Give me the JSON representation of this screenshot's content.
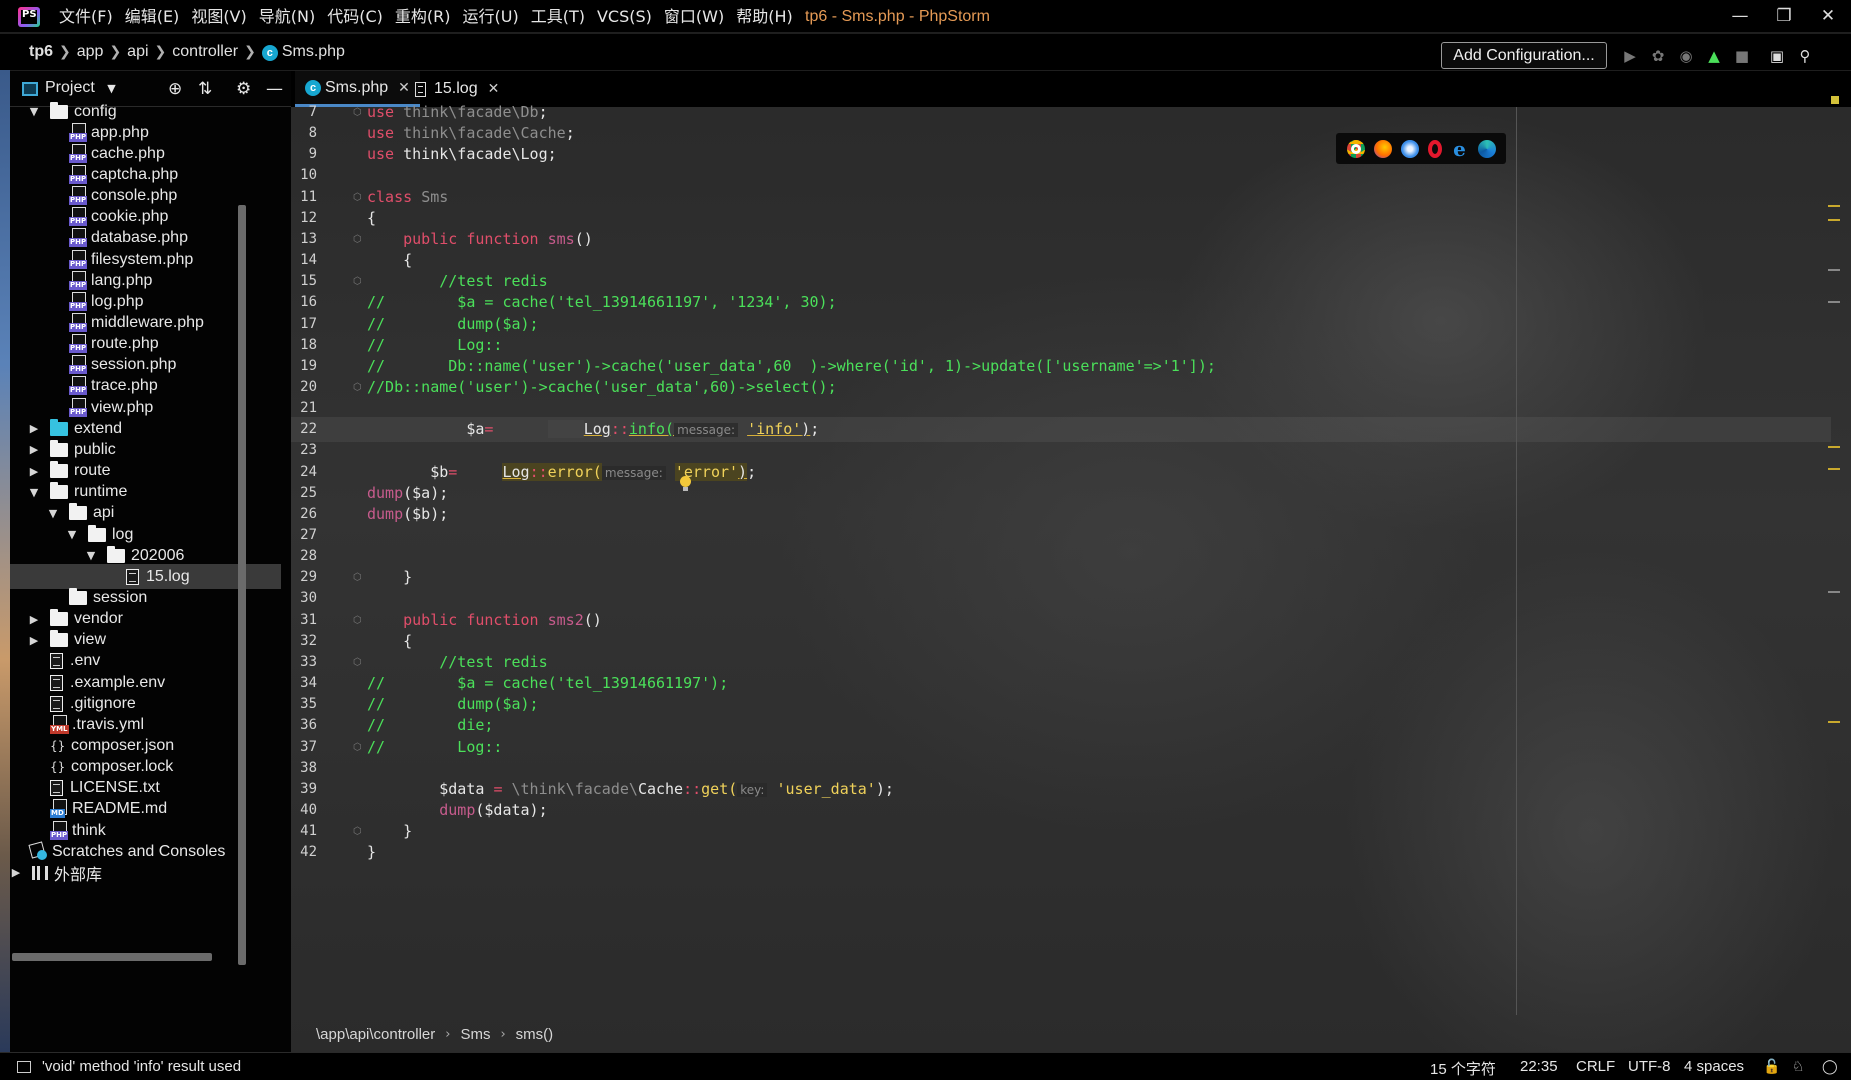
{
  "window": {
    "title": "tp6 - Sms.php - PhpStorm",
    "logo_text": "PS",
    "menu": [
      "文件(F)",
      "编辑(E)",
      "视图(V)",
      "导航(N)",
      "代码(C)",
      "重构(R)",
      "运行(U)",
      "工具(T)",
      "VCS(S)",
      "窗口(W)",
      "帮助(H)"
    ]
  },
  "navbar": {
    "breadcrumb": [
      "tp6",
      "app",
      "api",
      "controller",
      "Sms.php"
    ],
    "add_configuration": "Add Configuration..."
  },
  "project": {
    "title": "Project",
    "tree": [
      {
        "label": "config",
        "type": "folder",
        "depth": 1,
        "expanded": true
      },
      {
        "label": "app.php",
        "type": "php",
        "depth": 2
      },
      {
        "label": "cache.php",
        "type": "php",
        "depth": 2
      },
      {
        "label": "captcha.php",
        "type": "php",
        "depth": 2
      },
      {
        "label": "console.php",
        "type": "php",
        "depth": 2
      },
      {
        "label": "cookie.php",
        "type": "php",
        "depth": 2
      },
      {
        "label": "database.php",
        "type": "php",
        "depth": 2
      },
      {
        "label": "filesystem.php",
        "type": "php",
        "depth": 2
      },
      {
        "label": "lang.php",
        "type": "php",
        "depth": 2
      },
      {
        "label": "log.php",
        "type": "php",
        "depth": 2
      },
      {
        "label": "middleware.php",
        "type": "php",
        "depth": 2
      },
      {
        "label": "route.php",
        "type": "php",
        "depth": 2
      },
      {
        "label": "session.php",
        "type": "php",
        "depth": 2
      },
      {
        "label": "trace.php",
        "type": "php",
        "depth": 2
      },
      {
        "label": "view.php",
        "type": "php",
        "depth": 2
      },
      {
        "label": "extend",
        "type": "folder-cyan",
        "depth": 1,
        "expanded": false
      },
      {
        "label": "public",
        "type": "folder",
        "depth": 1,
        "expanded": false
      },
      {
        "label": "route",
        "type": "folder",
        "depth": 1,
        "expanded": false
      },
      {
        "label": "runtime",
        "type": "folder",
        "depth": 1,
        "expanded": true
      },
      {
        "label": "api",
        "type": "folder",
        "depth": 2,
        "expanded": true
      },
      {
        "label": "log",
        "type": "folder",
        "depth": 3,
        "expanded": true
      },
      {
        "label": "202006",
        "type": "folder",
        "depth": 4,
        "expanded": true
      },
      {
        "label": "15.log",
        "type": "log",
        "depth": 5,
        "selected": true
      },
      {
        "label": "session",
        "type": "folder",
        "depth": 2,
        "leaf": true
      },
      {
        "label": "vendor",
        "type": "folder",
        "depth": 1,
        "expanded": false
      },
      {
        "label": "view",
        "type": "folder",
        "depth": 1,
        "expanded": false
      },
      {
        "label": ".env",
        "type": "txt",
        "depth": 1
      },
      {
        "label": ".example.env",
        "type": "txt",
        "depth": 1
      },
      {
        "label": ".gitignore",
        "type": "txt",
        "depth": 1
      },
      {
        "label": ".travis.yml",
        "type": "yml",
        "depth": 1
      },
      {
        "label": "composer.json",
        "type": "json",
        "depth": 1
      },
      {
        "label": "composer.lock",
        "type": "json",
        "depth": 1
      },
      {
        "label": "LICENSE.txt",
        "type": "txt",
        "depth": 1
      },
      {
        "label": "README.md",
        "type": "md",
        "depth": 1
      },
      {
        "label": "think",
        "type": "php",
        "depth": 1
      },
      {
        "label": "Scratches and Consoles",
        "type": "scratch",
        "depth": 0
      },
      {
        "label": "外部库",
        "type": "lib",
        "depth": 0,
        "expanded": false
      }
    ]
  },
  "tabs": [
    {
      "label": "Sms.php",
      "icon": "php-class-icon",
      "active": true
    },
    {
      "label": "15.log",
      "icon": "log-file-icon",
      "active": false
    }
  ],
  "code_lines": [
    {
      "n": "7",
      "tokens": [
        [
          "kw",
          "use "
        ],
        [
          "dim",
          "think\\facade\\Db"
        ],
        [
          "txt",
          ";"
        ]
      ]
    },
    {
      "n": "8",
      "tokens": [
        [
          "kw",
          "use "
        ],
        [
          "dim",
          "think\\facade\\Cache"
        ],
        [
          "txt",
          ";"
        ]
      ]
    },
    {
      "n": "9",
      "tokens": [
        [
          "kw",
          "use "
        ],
        [
          "txt",
          "think\\facade\\Log;"
        ]
      ]
    },
    {
      "n": "10",
      "tokens": []
    },
    {
      "n": "11",
      "tokens": [
        [
          "kw",
          "class "
        ],
        [
          "dim",
          "Sms"
        ]
      ]
    },
    {
      "n": "12",
      "tokens": [
        [
          "txt",
          "{"
        ]
      ]
    },
    {
      "n": "13",
      "tokens": [
        [
          "txt",
          "    "
        ],
        [
          "kw",
          "public function "
        ],
        [
          "fn",
          "sms"
        ],
        [
          "txt",
          "()"
        ]
      ]
    },
    {
      "n": "14",
      "tokens": [
        [
          "txt",
          "    {"
        ]
      ]
    },
    {
      "n": "15",
      "tokens": [
        [
          "cm",
          "        //test redis"
        ]
      ]
    },
    {
      "n": "16",
      "tokens": [
        [
          "cm",
          "//        $a = cache('tel_13914661197', '1234', 30);"
        ]
      ]
    },
    {
      "n": "17",
      "tokens": [
        [
          "cm",
          "//        dump($a);"
        ]
      ]
    },
    {
      "n": "18",
      "tokens": [
        [
          "cm",
          "//        Log::"
        ]
      ]
    },
    {
      "n": "19",
      "tokens": [
        [
          "cm",
          "//       Db::name('user')->cache('user_data',60  )->where('id', 1)->update(['username'=>'1']);"
        ]
      ]
    },
    {
      "n": "20",
      "tokens": [
        [
          "cm",
          "//Db::name('user')->cache('user_data',60)->select();"
        ]
      ]
    },
    {
      "n": "21",
      "tokens": []
    },
    {
      "n": "22",
      "tokens": [
        [
          "txt",
          "           $a"
        ],
        [
          "op",
          "="
        ],
        [
          "txt",
          "      "
        ],
        [
          "sel",
          "    "
        ],
        [
          "wul",
          "Log"
        ],
        [
          "dimc",
          "::"
        ],
        [
          "wulg",
          "info("
        ],
        [
          "hint",
          "message:"
        ],
        [
          "txt",
          " "
        ],
        [
          "wstr",
          "'info'"
        ],
        [
          "wul",
          ")"
        ],
        [
          "txt",
          ";"
        ]
      ]
    },
    {
      "n": "23",
      "tokens": []
    },
    {
      "n": "24",
      "tokens": [
        [
          "txt",
          "       $b"
        ],
        [
          "op",
          "="
        ],
        [
          "txt",
          "     "
        ],
        [
          "hlul",
          "Log"
        ],
        [
          "hldim",
          "::"
        ],
        [
          "hlfn",
          "error("
        ],
        [
          "hint",
          "message:"
        ],
        [
          "txt",
          " "
        ],
        [
          "hlstr",
          "'error'"
        ],
        [
          "hlul",
          ")"
        ],
        [
          "txt",
          ";"
        ]
      ]
    },
    {
      "n": "25",
      "tokens": [
        [
          "fn",
          "dump"
        ],
        [
          "txt",
          "($a);"
        ]
      ]
    },
    {
      "n": "26",
      "tokens": [
        [
          "fn",
          "dump"
        ],
        [
          "txt",
          "($b);"
        ]
      ]
    },
    {
      "n": "27",
      "tokens": []
    },
    {
      "n": "28",
      "tokens": []
    },
    {
      "n": "29",
      "tokens": [
        [
          "txt",
          "    }"
        ]
      ]
    },
    {
      "n": "30",
      "tokens": []
    },
    {
      "n": "31",
      "tokens": [
        [
          "txt",
          "    "
        ],
        [
          "kw",
          "public function "
        ],
        [
          "fn",
          "sms2"
        ],
        [
          "txt",
          "()"
        ]
      ]
    },
    {
      "n": "32",
      "tokens": [
        [
          "txt",
          "    {"
        ]
      ]
    },
    {
      "n": "33",
      "tokens": [
        [
          "cm",
          "        //test redis"
        ]
      ]
    },
    {
      "n": "34",
      "tokens": [
        [
          "cm",
          "//        $a = cache('tel_13914661197');"
        ]
      ]
    },
    {
      "n": "35",
      "tokens": [
        [
          "cm",
          "//        dump($a);"
        ]
      ]
    },
    {
      "n": "36",
      "tokens": [
        [
          "cm",
          "//        die;"
        ]
      ]
    },
    {
      "n": "37",
      "tokens": [
        [
          "cm",
          "//        Log::"
        ]
      ]
    },
    {
      "n": "38",
      "tokens": []
    },
    {
      "n": "39",
      "tokens": [
        [
          "txt",
          "        $data "
        ],
        [
          "op",
          "="
        ],
        [
          "txt",
          " "
        ],
        [
          "dim",
          "\\think\\facade\\"
        ],
        [
          "txt",
          "Cache"
        ],
        [
          "dimc",
          "::"
        ],
        [
          "fnl",
          "get("
        ],
        [
          "hint",
          "key:"
        ],
        [
          "txt",
          " "
        ],
        [
          "str",
          "'user_data'"
        ],
        [
          "txt",
          ");"
        ]
      ]
    },
    {
      "n": "40",
      "tokens": [
        [
          "txt",
          "        "
        ],
        [
          "fn",
          "dump"
        ],
        [
          "txt",
          "($data);"
        ]
      ]
    },
    {
      "n": "41",
      "tokens": [
        [
          "txt",
          "    }"
        ]
      ]
    },
    {
      "n": "42",
      "tokens": [
        [
          "txt",
          "}"
        ]
      ]
    }
  ],
  "current_line": "22",
  "editor_breadcrumb": [
    "\\app\\api\\controller",
    "Sms",
    "sms()"
  ],
  "browsers": [
    "chrome-icon",
    "firefox-icon",
    "safari-icon",
    "opera-icon",
    "ie-icon",
    "edge-icon"
  ],
  "status": {
    "message": "'void' method 'info' result used",
    "chars": "15 个字符",
    "position": "22:35",
    "line_ending": "CRLF",
    "encoding": "UTF-8",
    "indent": "4 spaces"
  },
  "colors": {
    "keyword": "#e04e6a",
    "comment": "#4be05a",
    "string": "#f0d25a",
    "accent": "#4a88c7",
    "title": "#e59a55"
  }
}
